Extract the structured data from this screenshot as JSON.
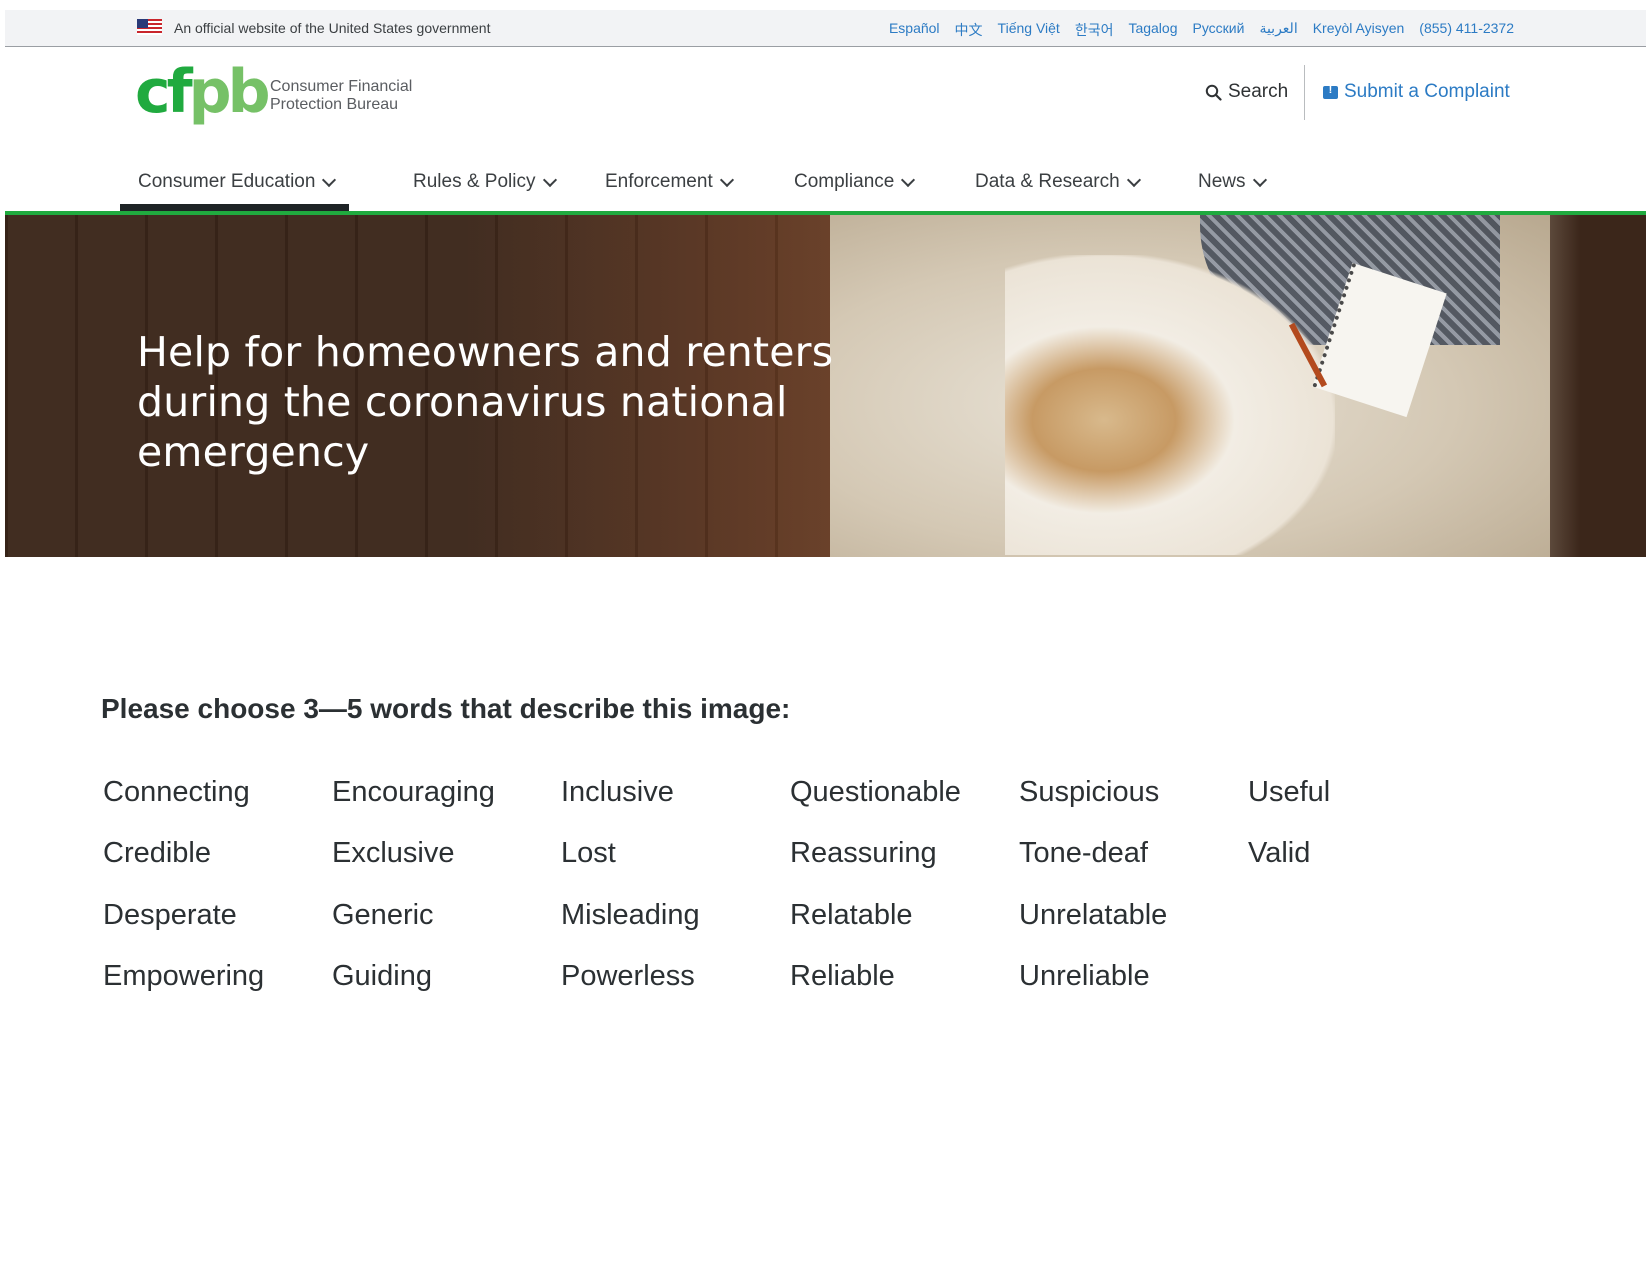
{
  "gov_banner": {
    "text": "An official website of the United States government",
    "languages": [
      "Español",
      "中文",
      "Tiếng Việt",
      "한국어",
      "Tagalog",
      "Русский",
      "العربية",
      "Kreyòl Ayisyen",
      "(855) 411-2372"
    ]
  },
  "header": {
    "logo": {
      "mark": "cfpb",
      "line1": "Consumer Financial",
      "line2": "Protection Bureau"
    },
    "search_label": "Search",
    "complaint_label": "Submit a Complaint"
  },
  "nav": {
    "items": [
      "Consumer Education",
      "Rules & Policy",
      "Enforcement",
      "Compliance",
      "Data & Research",
      "News"
    ],
    "active_index": 0
  },
  "hero": {
    "title": "Help for homeowners and renters during the coronavirus national emergency"
  },
  "survey": {
    "question": "Please choose 3—5 words that describe this image:",
    "columns": [
      [
        "Connecting",
        "Credible",
        "Desperate",
        "Empowering"
      ],
      [
        "Encouraging",
        "Exclusive",
        "Generic",
        "Guiding"
      ],
      [
        "Inclusive",
        "Lost",
        "Misleading",
        "Powerless"
      ],
      [
        "Questionable",
        "Reassuring",
        "Relatable",
        "Reliable"
      ],
      [
        "Suspicious",
        "Tone-deaf",
        "Unrelatable",
        "Unreliable"
      ],
      [
        "Useful",
        "Valid"
      ]
    ]
  },
  "colors": {
    "brand_green": "#20aa3f",
    "link_blue": "#2c7bc4",
    "hero_brown": "#3b261a"
  }
}
